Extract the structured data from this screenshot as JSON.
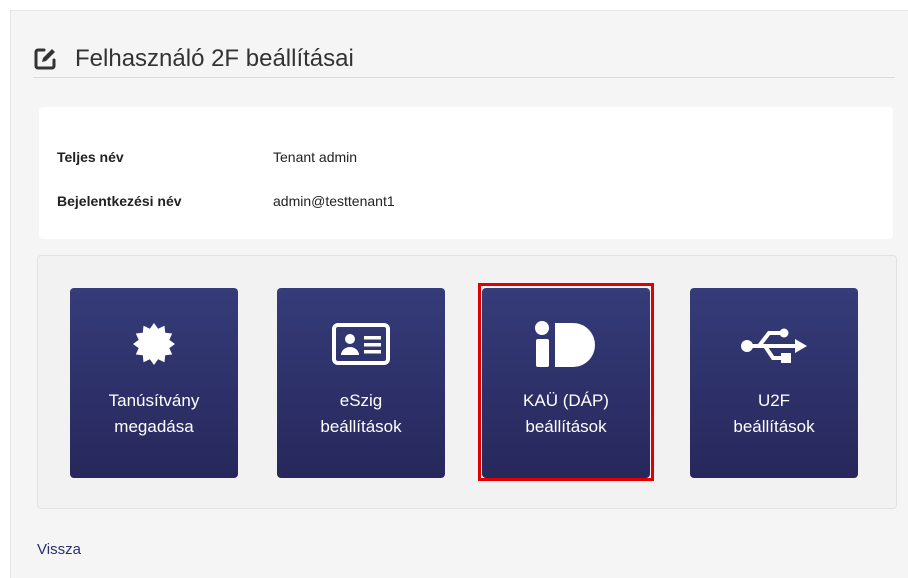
{
  "page": {
    "title": "Felhasználó 2F beállításai",
    "title_icon": "edit-icon"
  },
  "user_info": {
    "fullname_label": "Teljes név",
    "fullname_value": "Tenant admin",
    "login_label": "Bejelentkezési név",
    "login_value": "admin@testtenant1"
  },
  "tiles": [
    {
      "label": "Tanúsítvány\nmegadása",
      "icon": "certificate-seal-icon"
    },
    {
      "label": "eSzig\nbeállítások",
      "icon": "id-card-icon"
    },
    {
      "label": "KAÜ (DÁP)\nbeállítások",
      "icon": "id-logo-icon",
      "highlighted": true
    },
    {
      "label": "U2F\nbeállítások",
      "icon": "usb-icon"
    }
  ],
  "colors": {
    "tile_background": "#2e3068",
    "highlight_border": "#e00000",
    "link": "#2a2f6f"
  },
  "footer": {
    "back_link": "Vissza"
  }
}
